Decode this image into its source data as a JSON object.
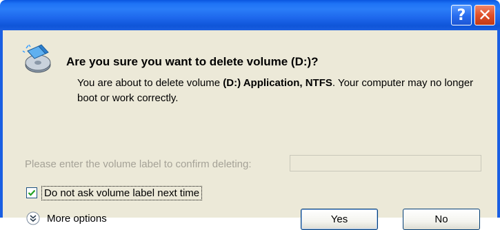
{
  "titlebar": {
    "help_label": "?",
    "close_label": "✕"
  },
  "message": {
    "title": "Are you sure you want to delete volume (D:)?",
    "line_prefix": "You are about to delete volume ",
    "line_volume": "(D:) Application, NTFS",
    "line_suffix": ". Your computer may no longer boot or work correctly."
  },
  "confirm": {
    "prompt": "Please enter the volume label to confirm deleting:",
    "input_value": "",
    "input_enabled": false
  },
  "checkbox": {
    "label": "Do not ask volume label next time",
    "checked": true
  },
  "more_options": {
    "label": "More options"
  },
  "buttons": {
    "yes": "Yes",
    "no": "No"
  },
  "colors": {
    "titlebar": "#1e73f5",
    "dialog_bg": "#ece9d8",
    "disabled_text": "#a5a297",
    "close_button": "#e0502a"
  },
  "icons": {
    "dialog": "disk-eraser-icon",
    "help": "help-icon",
    "close": "close-icon",
    "more": "chevron-down-circle-icon",
    "check": "checkmark-icon"
  }
}
